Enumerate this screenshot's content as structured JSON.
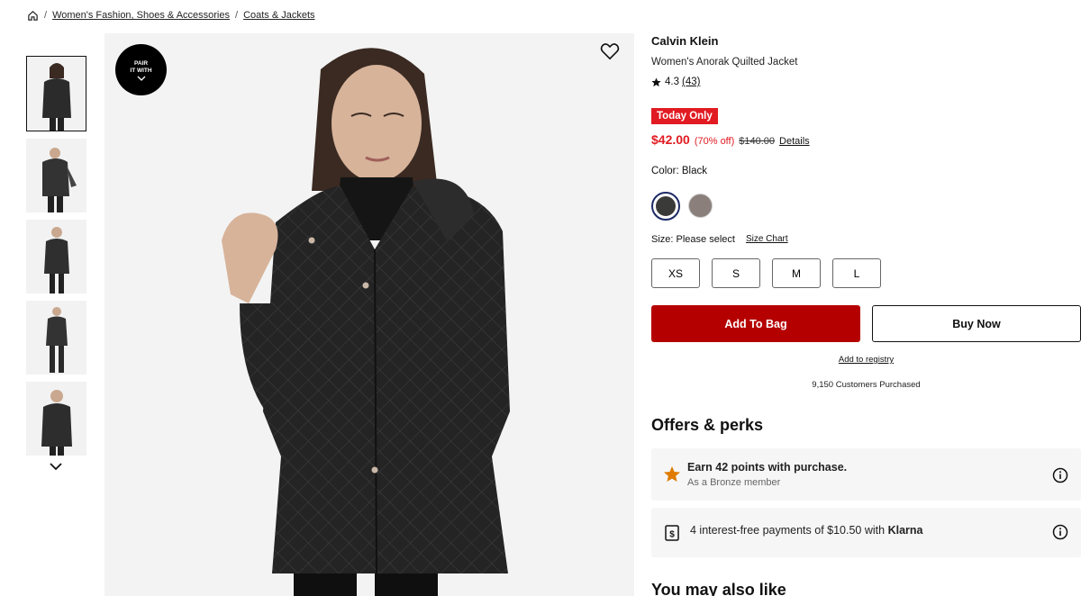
{
  "breadcrumb": {
    "items": [
      "Women's Fashion, Shoes & Accessories",
      "Coats & Jackets"
    ]
  },
  "gallery": {
    "pair_badge_line1": "PAIR",
    "pair_badge_line2": "IT WITH",
    "thumbnail_count": 5
  },
  "product": {
    "brand": "Calvin Klein",
    "name": "Women's Anorak Quilted Jacket",
    "rating": "4.3",
    "review_count": "(43)",
    "badge": "Today Only",
    "sale_price": "$42.00",
    "discount": "(70% off)",
    "original_price": "$140.00",
    "details_link": "Details",
    "color_label": "Color: Black",
    "size_label": "Size: Please select",
    "size_chart": "Size Chart",
    "sizes": [
      "XS",
      "S",
      "M",
      "L"
    ],
    "add_to_bag": "Add To Bag",
    "buy_now": "Buy Now",
    "add_to_registry": "Add to registry",
    "customers_purchased": "9,150 Customers Purchased"
  },
  "offers": {
    "title": "Offers & perks",
    "points_title": "Earn 42 points with purchase.",
    "points_subtitle": "As a Bronze member",
    "klarna_text": "4 interest-free payments of $10.50 with",
    "klarna_brand": "Klarna"
  },
  "also_like": "You may also like",
  "colors": {
    "accent_red": "#e11b22",
    "bag_red": "#b50000",
    "selected_swatch": "#3a3a38",
    "other_swatch": "#8a7f7a",
    "star_orange": "#e07b00"
  }
}
